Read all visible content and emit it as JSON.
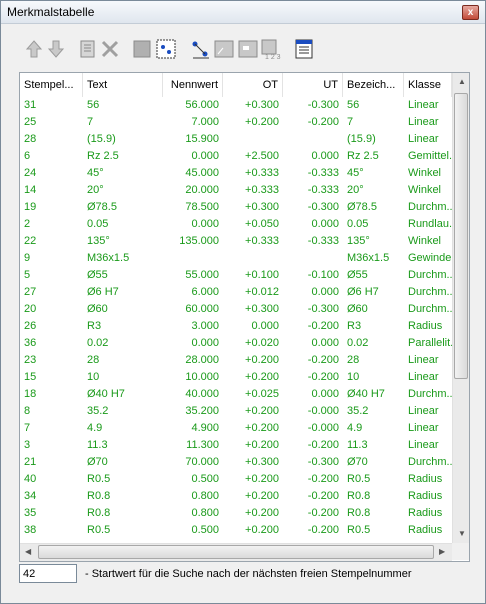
{
  "window": {
    "title": "Merkmalstabelle",
    "close_glyph": "x"
  },
  "toolbar": [
    {
      "name": "move-up-icon"
    },
    {
      "name": "move-down-icon"
    },
    {
      "name": "list-icon"
    },
    {
      "name": "delete-icon"
    },
    {
      "name": "block-icon"
    },
    {
      "name": "select-points-icon"
    },
    {
      "name": "measure-icon"
    },
    {
      "name": "tolerance-icon"
    },
    {
      "name": "tolerance-block-icon"
    },
    {
      "name": "numbering-icon"
    },
    {
      "name": "table-icon"
    }
  ],
  "columns": [
    "Stempel...",
    "Text",
    "Nennwert",
    "OT",
    "UT",
    "Bezeich...",
    "Klasse"
  ],
  "rows": [
    [
      "31",
      "56",
      "56.000",
      "+0.300",
      "-0.300",
      "56",
      "Linear"
    ],
    [
      "25",
      "7",
      "7.000",
      "+0.200",
      "-0.200",
      "7",
      "Linear"
    ],
    [
      "28",
      "(15.9)",
      "15.900",
      "",
      "",
      "(15.9)",
      "Linear"
    ],
    [
      "6",
      "Rz 2.5",
      "0.000",
      "+2.500",
      "0.000",
      "Rz 2.5",
      "Gemittel..."
    ],
    [
      "24",
      "45°",
      "45.000",
      "+0.333",
      "-0.333",
      "45°",
      "Winkel"
    ],
    [
      "14",
      "20°",
      "20.000",
      "+0.333",
      "-0.333",
      "20°",
      "Winkel"
    ],
    [
      "19",
      "Ø78.5",
      "78.500",
      "+0.300",
      "-0.300",
      "Ø78.5",
      "Durchm..."
    ],
    [
      "2",
      "0.05",
      "0.000",
      "+0.050",
      "0.000",
      "0.05",
      "Rundlau..."
    ],
    [
      "22",
      "135°",
      "135.000",
      "+0.333",
      "-0.333",
      "135°",
      "Winkel"
    ],
    [
      "9",
      "M36x1.5",
      "",
      "",
      "",
      "M36x1.5",
      "Gewinde"
    ],
    [
      "5",
      "Ø55",
      "55.000",
      "+0.100",
      "-0.100",
      "Ø55",
      "Durchm..."
    ],
    [
      "27",
      "Ø6 H7",
      "6.000",
      "+0.012",
      "0.000",
      "Ø6 H7",
      "Durchm..."
    ],
    [
      "20",
      "Ø60",
      "60.000",
      "+0.300",
      "-0.300",
      "Ø60",
      "Durchm..."
    ],
    [
      "26",
      "R3",
      "3.000",
      "0.000",
      "-0.200",
      "R3",
      "Radius"
    ],
    [
      "36",
      "0.02",
      "0.000",
      "+0.020",
      "0.000",
      "0.02",
      "Parallelit..."
    ],
    [
      "23",
      "28",
      "28.000",
      "+0.200",
      "-0.200",
      "28",
      "Linear"
    ],
    [
      "15",
      "10",
      "10.000",
      "+0.200",
      "-0.200",
      "10",
      "Linear"
    ],
    [
      "18",
      "Ø40 H7",
      "40.000",
      "+0.025",
      "0.000",
      "Ø40 H7",
      "Durchm..."
    ],
    [
      "8",
      "35.2",
      "35.200",
      "+0.200",
      "-0.000",
      "35.2",
      "Linear"
    ],
    [
      "7",
      "4.9",
      "4.900",
      "+0.200",
      "-0.000",
      "4.9",
      "Linear"
    ],
    [
      "3",
      "11.3",
      "11.300",
      "+0.200",
      "-0.200",
      "11.3",
      "Linear"
    ],
    [
      "21",
      "Ø70",
      "70.000",
      "+0.300",
      "-0.300",
      "Ø70",
      "Durchm..."
    ],
    [
      "40",
      "R0.5",
      "0.500",
      "+0.200",
      "-0.200",
      "R0.5",
      "Radius"
    ],
    [
      "34",
      "R0.8",
      "0.800",
      "+0.200",
      "-0.200",
      "R0.8",
      "Radius"
    ],
    [
      "35",
      "R0.8",
      "0.800",
      "+0.200",
      "-0.200",
      "R0.8",
      "Radius"
    ],
    [
      "38",
      "R0.5",
      "0.500",
      "+0.200",
      "-0.200",
      "R0.5",
      "Radius"
    ]
  ],
  "start_value": {
    "value": "42"
  },
  "hint": "- Startwert für die Suche nach der nächsten freien Stempelnummer",
  "colors": {
    "cell_text": "#1a9a1a"
  }
}
